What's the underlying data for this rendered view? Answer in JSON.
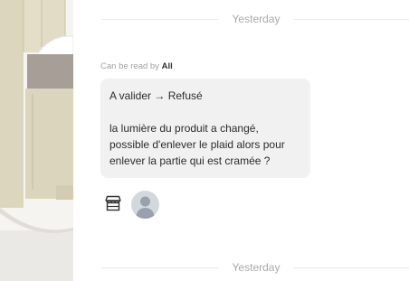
{
  "messages": {
    "divider_top": "Yesterday",
    "divider_bottom": "Yesterday",
    "read_by_prefix": "Can be read by",
    "read_by_value": "All",
    "bubble": {
      "line1": "A valider → Refusé",
      "line2": "la lumière du produit a changé,",
      "line3": "possible d'enlever le plaid alors pour",
      "line4": "enlever la partie qui est cramée ?"
    },
    "sender_icons": [
      "store-icon",
      "user-avatar"
    ]
  }
}
